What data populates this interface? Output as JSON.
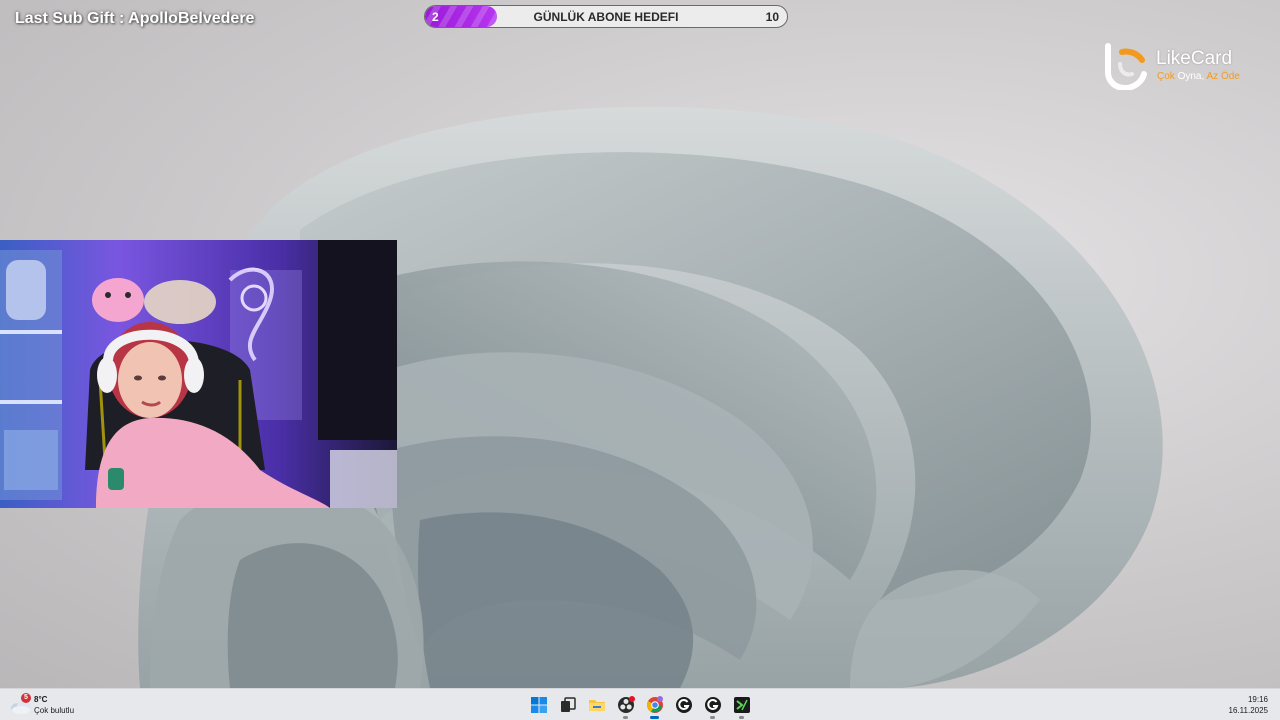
{
  "overlay": {
    "last_sub_gift": "Last Sub Gift : ApolloBelvedere",
    "sub_goal": {
      "current": "2",
      "title": "GÜNLÜK ABONE HEDEFI",
      "target": "10",
      "progress_fraction": 0.2
    }
  },
  "brand": {
    "name": "LikeCard",
    "tagline_part1": "Çok",
    "tagline_part2": "Oyna,",
    "tagline_part3": "Az Öde",
    "colors": {
      "orange": "#f39a1e",
      "white": "#ffffff"
    }
  },
  "webcam": {
    "icon": "webcam-feed"
  },
  "taskbar": {
    "weather": {
      "badge": "5",
      "temperature": "8°C",
      "condition": "Çok bulutlu",
      "icon": "cloud-icon"
    },
    "apps": [
      {
        "name": "start-button",
        "icon": "windows-logo-icon"
      },
      {
        "name": "task-view-button",
        "icon": "task-view-icon"
      },
      {
        "name": "file-explorer-button",
        "icon": "folder-icon"
      },
      {
        "name": "obs-button",
        "icon": "obs-icon"
      },
      {
        "name": "chrome-button",
        "icon": "chrome-icon"
      },
      {
        "name": "g-app-button-1",
        "icon": "g-circle-icon"
      },
      {
        "name": "g-app-button-2",
        "icon": "g-circle-icon"
      },
      {
        "name": "terminal-app-button",
        "icon": "terminal-icon"
      }
    ],
    "clock": {
      "time": "19:16",
      "date": "16.11.2025"
    }
  },
  "colors": {
    "goal_fill": "#9a1ad8",
    "taskbar_bg": "#e6e8ec",
    "accent_blue": "#0067c0"
  }
}
